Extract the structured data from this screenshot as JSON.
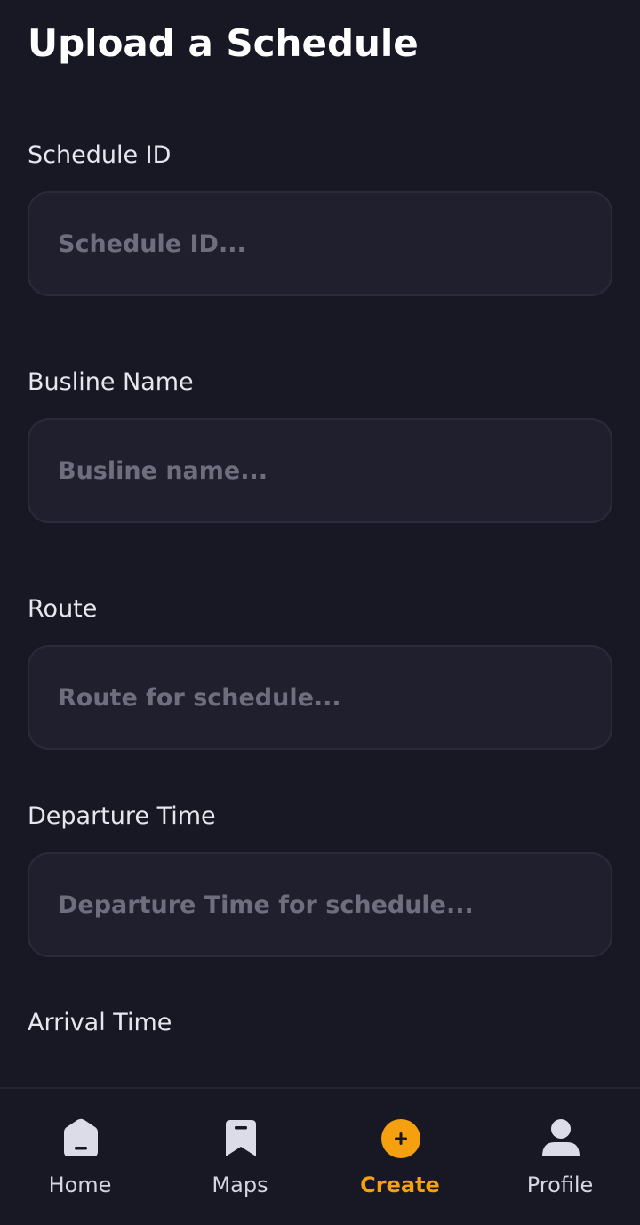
{
  "header": {
    "title": "Upload a Schedule"
  },
  "form": {
    "fields": [
      {
        "label": "Schedule ID",
        "placeholder": "Schedule ID...",
        "value": ""
      },
      {
        "label": "Busline Name",
        "placeholder": "Busline name...",
        "value": ""
      },
      {
        "label": "Route",
        "placeholder": "Route for schedule...",
        "value": ""
      },
      {
        "label": "Departure Time",
        "placeholder": "Departure Time for schedule...",
        "value": ""
      },
      {
        "label": "Arrival Time"
      }
    ]
  },
  "nav": {
    "items": [
      {
        "label": "Home",
        "icon": "home-icon"
      },
      {
        "label": "Maps",
        "icon": "bookmark-icon"
      },
      {
        "label": "Create",
        "icon": "plus-circle-icon",
        "active": true
      },
      {
        "label": "Profile",
        "icon": "person-icon"
      }
    ]
  },
  "colors": {
    "background": "#181824",
    "input_background": "#1f1f2e",
    "accent": "#f5a00f",
    "icon": "#dcdce8"
  }
}
